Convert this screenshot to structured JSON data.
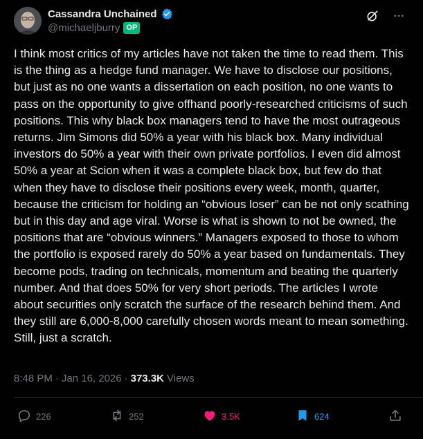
{
  "author": {
    "display_name": "Cassandra Unchained",
    "handle": "@michaeljburry",
    "badge": "OP",
    "verified": true
  },
  "post": {
    "text": "I think most critics of my articles have not taken the time to read them. This is the thing as a hedge fund manager. We have to disclose our positions, but just as no one wants a dissertation on each position, no one wants  to pass on the opportunity to give offhand poorly-researched criticisms of such positions. This why black box managers tend to have the most outrageous returns. Jim Simons did 50% a year with his black box. Many individual investors do 50% a year with their own private portfolios. I even did almost 50% a year at Scion when it was a complete black box, but few do that when they have to disclose their positions every week, month, quarter, because the criticism for holding an “obvious loser” can be not only scathing but in this day and age viral. Worse is what is shown to not be owned, the positions that are “obvious winners.” Managers exposed to those to whom the portfolio is exposed rarely do 50% a year based on fundamentals. They become pods, trading on technicals, momentum and beating the quarterly number. And that does 50% for very short periods. The articles I wrote about securities only scratch the surface of the research behind them. And they still are 6,000-8,000 carefully chosen words meant to mean something. Still, just a scratch.",
    "time": "8:48 PM",
    "date": "Jan 16, 2026",
    "separator": "·",
    "views_count": "373.3K",
    "views_label": "Views"
  },
  "actions": {
    "replies": "226",
    "reposts": "252",
    "likes": "3.5K",
    "bookmarks": "624"
  },
  "colors": {
    "background": "#000000",
    "text": "#e7e9ea",
    "muted": "#71767b",
    "like": "#f91880",
    "bookmark": "#1d9bf0",
    "verified": "#1d9bf0",
    "op_badge": "#00ba7c"
  },
  "icons": [
    "avatar",
    "verified-icon",
    "grok-icon",
    "more-icon",
    "reply-icon",
    "repost-icon",
    "like-icon",
    "bookmark-icon",
    "share-icon"
  ]
}
